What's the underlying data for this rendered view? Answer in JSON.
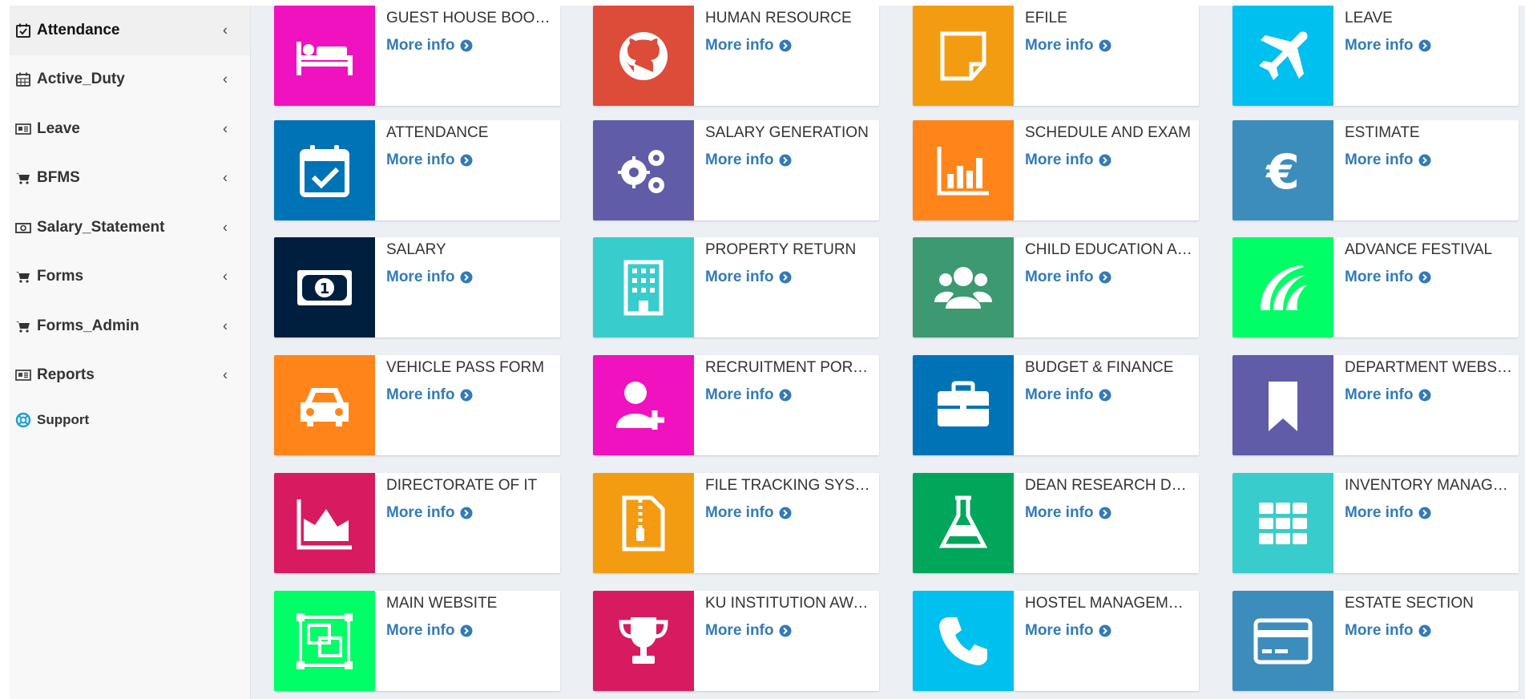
{
  "sidebar": {
    "items": [
      {
        "label": "Attendance",
        "icon": "calendar-check-icon"
      },
      {
        "label": "Active_Duty",
        "icon": "calendar-icon"
      },
      {
        "label": "Leave",
        "icon": "newspaper-icon"
      },
      {
        "label": "BFMS",
        "icon": "cart-icon"
      },
      {
        "label": "Salary_Statement",
        "icon": "money-icon"
      },
      {
        "label": "Forms",
        "icon": "cart-icon"
      },
      {
        "label": "Forms_Admin",
        "icon": "cart-icon"
      },
      {
        "label": "Reports",
        "icon": "newspaper-icon"
      }
    ],
    "support": {
      "label": "Support",
      "icon": "life-ring-icon"
    },
    "chevron": "‹"
  },
  "tiles": [
    {
      "title": "GUEST HOUSE BOOKING",
      "link": "More info",
      "icon": "bed-icon",
      "color": "#f012be"
    },
    {
      "title": "HUMAN RESOURCE",
      "link": "More info",
      "icon": "github-icon",
      "color": "#dd4b39"
    },
    {
      "title": "EFILE",
      "link": "More info",
      "icon": "sticky-note-icon",
      "color": "#f39c12"
    },
    {
      "title": "LEAVE",
      "link": "More info",
      "icon": "plane-icon",
      "color": "#00c0ef"
    },
    {
      "title": "ATTENDANCE",
      "link": "More info",
      "icon": "calendar-check-icon",
      "color": "#0073b7"
    },
    {
      "title": "SALARY GENERATION",
      "link": "More info",
      "icon": "gears-icon",
      "color": "#605ca8"
    },
    {
      "title": "SCHEDULE AND EXAM",
      "link": "More info",
      "icon": "bar-chart-icon",
      "color": "#ff851b"
    },
    {
      "title": "ESTIMATE",
      "link": "More info",
      "icon": "euro-icon",
      "color": "#3c8dbc"
    },
    {
      "title": "SALARY",
      "link": "More info",
      "icon": "money-bill-icon",
      "color": "#001f3f"
    },
    {
      "title": "PROPERTY RETURN",
      "link": "More info",
      "icon": "building-icon",
      "color": "#39cccc"
    },
    {
      "title": "CHILD EDUCATION ALLOWANCE",
      "link": "More info",
      "icon": "users-icon",
      "color": "#3d9970"
    },
    {
      "title": "ADVANCE FESTIVAL",
      "link": "More info",
      "icon": "pied-piper-icon",
      "color": "#00ff66"
    },
    {
      "title": "VEHICLE PASS FORM",
      "link": "More info",
      "icon": "car-icon",
      "color": "#ff851b"
    },
    {
      "title": "RECRUITMENT PORTAL",
      "link": "More info",
      "icon": "user-plus-icon",
      "color": "#f012be"
    },
    {
      "title": "BUDGET & FINANCE",
      "link": "More info",
      "icon": "briefcase-icon",
      "color": "#0073b7"
    },
    {
      "title": "DEPARTMENT WEBSITE",
      "link": "More info",
      "icon": "bookmark-icon",
      "color": "#605ca8"
    },
    {
      "title": "DIRECTORATE OF IT",
      "link": "More info",
      "icon": "area-chart-icon",
      "color": "#d81b60"
    },
    {
      "title": "FILE TRACKING SYSTEM",
      "link": "More info",
      "icon": "file-zip-icon",
      "color": "#f39c12"
    },
    {
      "title": "DEAN RESEARCH DEVELOPMENT",
      "link": "More info",
      "icon": "flask-icon",
      "color": "#00a65a"
    },
    {
      "title": "INVENTORY MANAGEMENT",
      "link": "More info",
      "icon": "th-icon",
      "color": "#39cccc"
    },
    {
      "title": "MAIN WEBSITE",
      "link": "More info",
      "icon": "object-group-icon",
      "color": "#00ff66"
    },
    {
      "title": "KU INSTITUTION AWARDS",
      "link": "More info",
      "icon": "trophy-icon",
      "color": "#d81b60"
    },
    {
      "title": "HOSTEL MANAGEMENT",
      "link": "More info",
      "icon": "phone-icon",
      "color": "#00c0ef"
    },
    {
      "title": "ESTATE SECTION",
      "link": "More info",
      "icon": "credit-card-icon",
      "color": "#3c8dbc"
    }
  ]
}
